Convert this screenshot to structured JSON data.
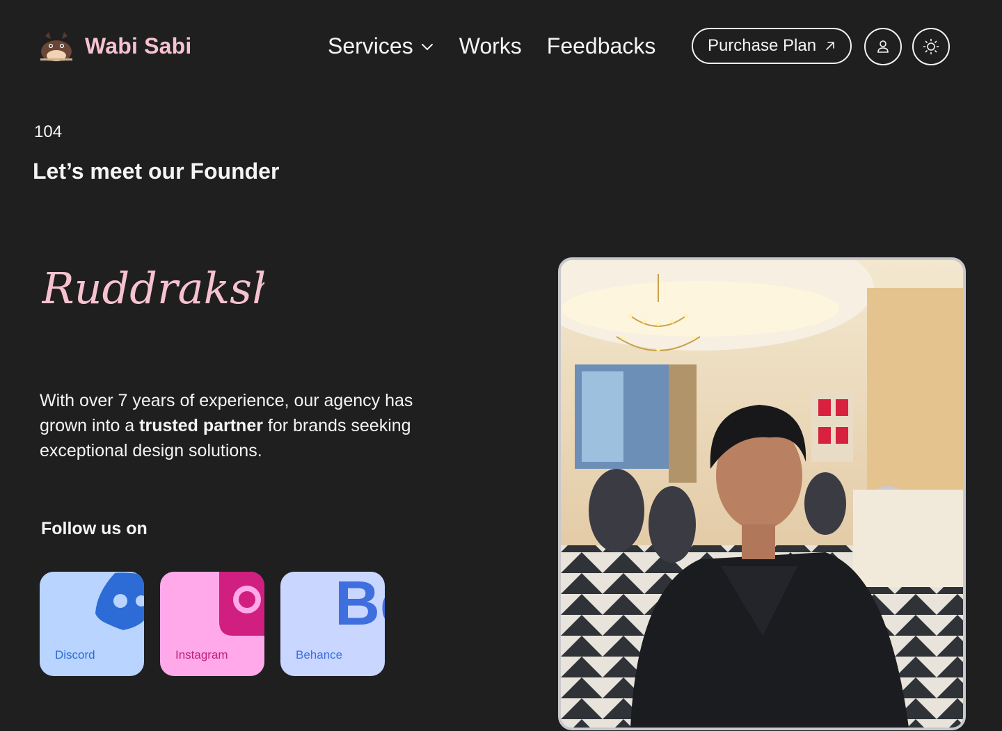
{
  "brand": {
    "name": "Wabi Sabi",
    "logo_icon": "totoro-icon"
  },
  "nav": {
    "items": [
      {
        "label": "Services",
        "has_dropdown": true
      },
      {
        "label": "Works"
      },
      {
        "label": "Feedbacks"
      }
    ],
    "purchase_label": "Purchase Plan",
    "purchase_icon": "arrow-up-right-icon",
    "user_icon": "user-icon",
    "theme_icon": "sun-icon"
  },
  "section": {
    "number": "104",
    "title": "Let’s meet our Founder"
  },
  "founder": {
    "signature": "Ruddraksh",
    "desc_part1": "With over 7 years of experience, our agency has grown into a ",
    "desc_bold": "trusted partner",
    "desc_part2": " for brands seeking exceptional design solutions.",
    "photo_icon": "founder-photo"
  },
  "social": {
    "heading": "Follow us on",
    "items": [
      {
        "label": "Discord",
        "icon": "discord-icon",
        "bg": "#b8d4ff",
        "color": "#2d6cd6"
      },
      {
        "label": "Instagram",
        "icon": "instagram-icon",
        "bg": "#ffa9ea",
        "color": "#c01f77"
      },
      {
        "label": "Behance",
        "icon": "behance-icon",
        "bg": "#c9d6ff",
        "color": "#3f6ede"
      }
    ]
  },
  "colors": {
    "background": "#1f1f20",
    "brand_pink": "#f7c2cf",
    "text": "#f4f4f4"
  }
}
